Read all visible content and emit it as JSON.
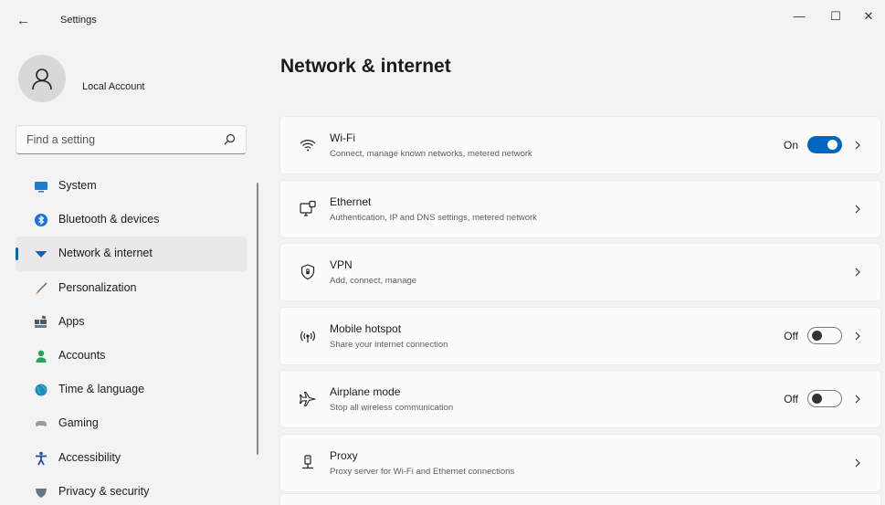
{
  "window": {
    "title": "Settings",
    "back_icon": "←",
    "minimize_icon": "—",
    "maximize_icon": "☐",
    "close_icon": "✕"
  },
  "account": {
    "name": "Local Account",
    "avatar_icon": "person-icon"
  },
  "search": {
    "placeholder": "Find a setting",
    "value": ""
  },
  "sidebar": {
    "items": [
      {
        "label": "System",
        "icon": "system-icon",
        "color": "#1f7ad1",
        "selected": false
      },
      {
        "label": "Bluetooth & devices",
        "icon": "bluetooth-icon",
        "color": "#1a73d8",
        "selected": false
      },
      {
        "label": "Network & internet",
        "icon": "network-icon",
        "color": "#1b5fb0",
        "selected": true
      },
      {
        "label": "Personalization",
        "icon": "brush-icon",
        "color": "#d0782c",
        "selected": false
      },
      {
        "label": "Apps",
        "icon": "apps-icon",
        "color": "#4a5a6a",
        "selected": false
      },
      {
        "label": "Accounts",
        "icon": "accounts-icon",
        "color": "#2aa05a",
        "selected": false
      },
      {
        "label": "Time & language",
        "icon": "globe-clock-icon",
        "color": "#1b8ad0",
        "selected": false
      },
      {
        "label": "Gaming",
        "icon": "gamepad-icon",
        "color": "#8a8a8a",
        "selected": false
      },
      {
        "label": "Accessibility",
        "icon": "accessibility-icon",
        "color": "#1b4fa8",
        "selected": false
      },
      {
        "label": "Privacy & security",
        "icon": "shield-icon",
        "color": "#6a7382",
        "selected": false
      }
    ]
  },
  "main": {
    "title": "Network & internet",
    "cards": [
      {
        "title": "Wi-Fi",
        "desc": "Connect, manage known networks, metered network",
        "icon": "wifi-icon",
        "state": "On",
        "toggle": "on"
      },
      {
        "title": "Ethernet",
        "desc": "Authentication, IP and DNS settings, metered network",
        "icon": "ethernet-icon",
        "state": "",
        "toggle": "none"
      },
      {
        "title": "VPN",
        "desc": "Add, connect, manage",
        "icon": "vpn-shield-icon",
        "state": "",
        "toggle": "none"
      },
      {
        "title": "Mobile hotspot",
        "desc": "Share your internet connection",
        "icon": "hotspot-icon",
        "state": "Off",
        "toggle": "off"
      },
      {
        "title": "Airplane mode",
        "desc": "Stop all wireless communication",
        "icon": "airplane-icon",
        "state": "Off",
        "toggle": "off"
      },
      {
        "title": "Proxy",
        "desc": "Proxy server for Wi-Fi and Ethernet connections",
        "icon": "proxy-icon",
        "state": "",
        "toggle": "none"
      }
    ]
  },
  "colors": {
    "accent": "#0067c0",
    "background": "#f3f3f3",
    "card": "#fbfbfb"
  }
}
